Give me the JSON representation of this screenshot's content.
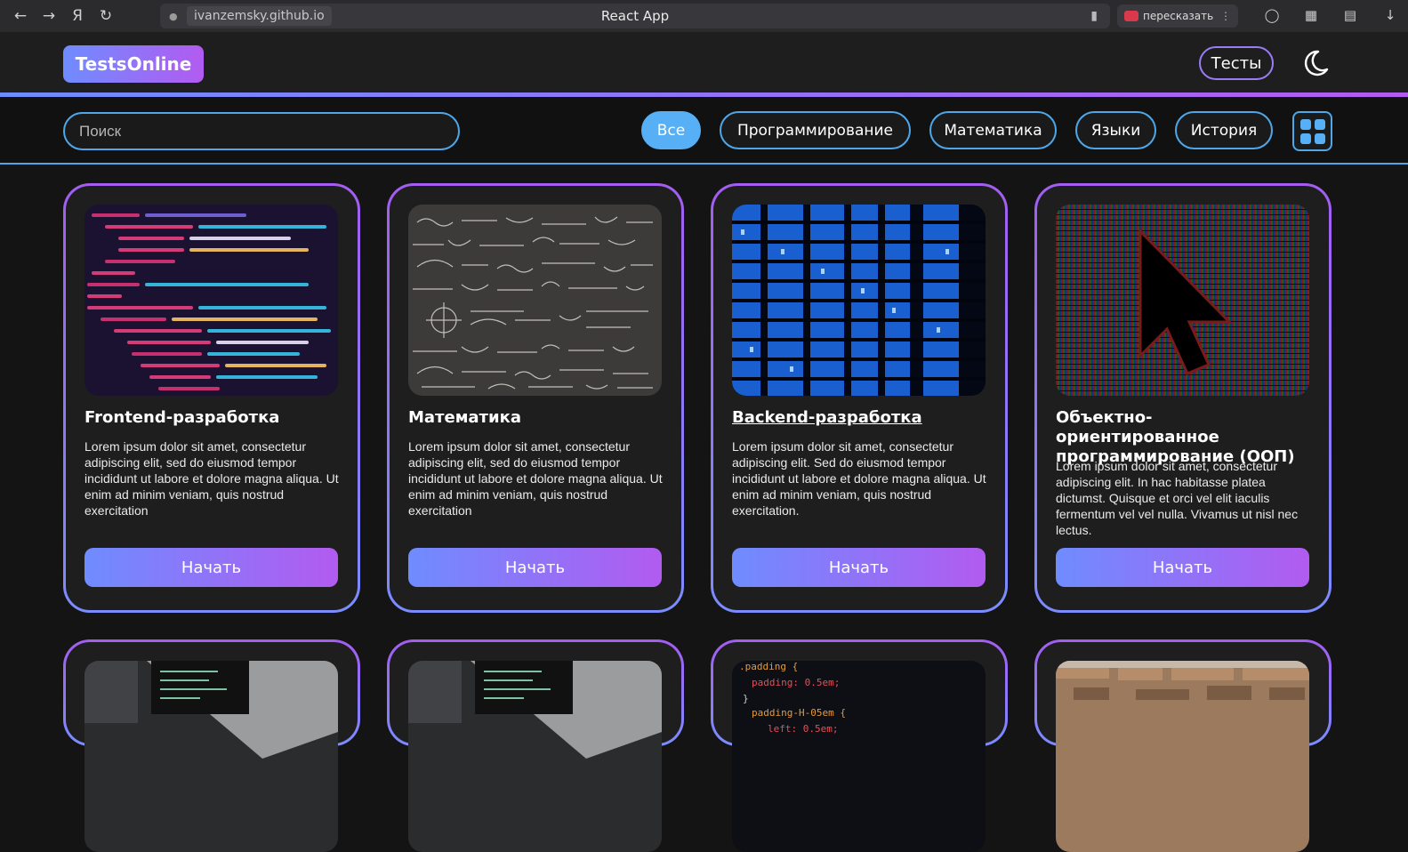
{
  "browser": {
    "url": "ivanzemsky.github.io",
    "tab_title": "React App",
    "retell_label": "пересказать"
  },
  "header": {
    "logo": "TestsOnline",
    "tests_button": "Тесты"
  },
  "filters": {
    "search_placeholder": "Поиск",
    "categories": [
      "Все",
      "Программирование",
      "Математика",
      "Языки",
      "История"
    ],
    "active": "Все"
  },
  "cards": [
    {
      "title": "Frontend-разработка",
      "description": "Lorem ipsum dolor sit amet, consectetur adipiscing elit, sed do eiusmod tempor incididunt ut labore et dolore magna aliqua. Ut enim ad minim veniam, quis nostrud exercitation",
      "button": "Начать",
      "image": "code-screen"
    },
    {
      "title": "Математика",
      "description": "Lorem ipsum dolor sit amet, consectetur adipiscing elit, sed do eiusmod tempor incididunt ut labore et dolore magna aliqua. Ut enim ad minim veniam, quis nostrud exercitation",
      "button": "Начать",
      "image": "chalkboard-formulas"
    },
    {
      "title": "Backend-разработка",
      "description": "Lorem ipsum dolor sit amet, consectetur adipiscing elit. Sed do eiusmod tempor incididunt ut labore et dolore magna aliqua. Ut enim ad minim veniam, quis nostrud exercitation.",
      "button": "Начать",
      "image": "server-racks"
    },
    {
      "title": "Объектно-ориентированное программирование (ООП)",
      "description": "Lorem ipsum dolor sit amet, consectetur adipiscing elit. In hac habitasse platea dictumst. Quisque et orci vel elit iaculis fermentum vel vel nulla. Vivamus ut nisl nec lectus.",
      "button": "Начать",
      "image": "pixel-cursor"
    }
  ],
  "cards_row2": [
    {
      "image": "laptop-code"
    },
    {
      "image": "laptop-code"
    },
    {
      "image": "css-code",
      "snippet": [
        ".padding {",
        "padding: 0.5em;",
        "}",
        "padding-H-05em {",
        "left: 0.5em;"
      ]
    },
    {
      "image": "city-aerial"
    }
  ],
  "colors": {
    "accent_blue": "#57b0f5",
    "gradient_start": "#6f8cff",
    "gradient_end": "#b25bf0"
  }
}
